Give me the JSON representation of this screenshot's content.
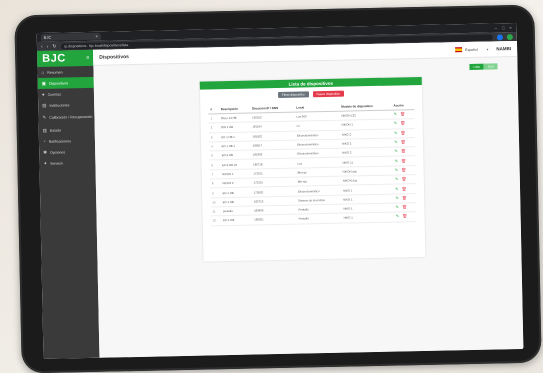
{
  "browser": {
    "tab_title": "BJC",
    "url": "ip.dispositivos · bjc.local/dispositivos/lista"
  },
  "app": {
    "brand": "BJC",
    "page_title": "Dispositivos",
    "language": "Español",
    "user": "NAMBI"
  },
  "sidebar": {
    "items": [
      {
        "label": "Resumen",
        "icon": "home-icon"
      },
      {
        "label": "Dispositivos",
        "icon": "device-icon",
        "active": true
      },
      {
        "label": "Cuentas",
        "icon": "user-icon"
      },
      {
        "label": "Instituciones",
        "icon": "building-icon"
      },
      {
        "label": "Calibración / Recuperación",
        "icon": "tool-icon"
      },
      {
        "label": "Estado",
        "icon": "chart-icon"
      },
      {
        "label": "Notificaciones",
        "icon": "bell-icon"
      },
      {
        "label": "Opciones",
        "icon": "gear-icon"
      },
      {
        "label": "Servicio",
        "icon": "wrench-icon"
      }
    ]
  },
  "toggle": {
    "on": "Lista",
    "off": "Grid"
  },
  "card": {
    "title": "Lista de dispositivos",
    "btn_filter": "Filtrar dispositivo",
    "btn_new": "Nuevo dispositivo",
    "columns": [
      "#",
      "Descripción",
      "Dirección IP / DNS",
      "Local",
      "Modelo de dispositivo",
      "Acción"
    ],
    "rows": [
      [
        "1",
        "Disco 12 HB",
        "192512",
        "Las 900",
        "NIKON L32"
      ],
      [
        "2",
        "DIN 1 HB",
        "181514",
        "Lu",
        "NIKON 1"
      ],
      [
        "3",
        "EC-1 HB 1",
        "181502",
        "Electrodoméstico",
        "NIKO 2"
      ],
      [
        "4",
        "EC-1 HB 1",
        "180517",
        "Electrodoméstico",
        "NIKO 2"
      ],
      [
        "5",
        "EC-5 HB",
        "181803",
        "Electrodoméstico",
        "NIKO 2"
      ],
      [
        "6",
        "EC-6 RD 24",
        "180718",
        "Luz",
        "NIKO 11"
      ],
      [
        "7",
        "NIKON 1",
        "172101",
        "Blu-ray",
        "NIKON day"
      ],
      [
        "8",
        "NIKON 2",
        "172101",
        "Blu-ray",
        "NIKON day"
      ],
      [
        "9",
        "EC-1 HB",
        "172602",
        "Electrodoméstico",
        "NIKO 1"
      ],
      [
        "10",
        "EC-1 HB",
        "182713",
        "Sistema de incendios",
        "NIKO 1"
      ],
      [
        "11",
        "pantalla",
        "180803",
        "Pantalla",
        "NIKO 1"
      ],
      [
        "12",
        "EC-1 HB",
        "180921",
        "Pantalla",
        "NIKO 1"
      ]
    ]
  }
}
